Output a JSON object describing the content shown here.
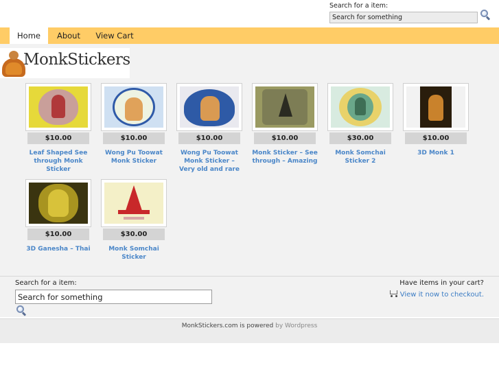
{
  "header": {
    "search_label": "Search for a item:",
    "search_value": "Search for something"
  },
  "nav": {
    "tabs": [
      {
        "label": "Home",
        "active": true
      },
      {
        "label": "About",
        "active": false
      },
      {
        "label": "View Cart",
        "active": false
      }
    ]
  },
  "logo": {
    "text": "MonkStickers",
    "icon": "monk-icon"
  },
  "products": [
    {
      "price": "$10.00",
      "name": "Leaf Shaped See through Monk Sticker"
    },
    {
      "price": "$10.00",
      "name": "Wong Pu Toowat Monk Sticker"
    },
    {
      "price": "$10.00",
      "name": "Wong Pu Toowat Monk Sticker – Very old and rare"
    },
    {
      "price": "$10.00",
      "name": "Monk Sticker – See through – Amazing"
    },
    {
      "price": "$30.00",
      "name": "Monk Somchai Sticker 2"
    },
    {
      "price": "$10.00",
      "name": "3D Monk 1"
    },
    {
      "price": "$10.00",
      "name": "3D Ganesha – Thai"
    },
    {
      "price": "$30.00",
      "name": "Monk Somchai Sticker"
    }
  ],
  "footer_search": {
    "label": "Search for a item:",
    "value": "Search for something"
  },
  "cart": {
    "question": "Have items in your cart?",
    "link": "View it now to checkout."
  },
  "powered": {
    "site": "MonkStickers.com is powered",
    "by": "by",
    "engine": "Wordpress"
  },
  "colors": {
    "nav_bg": "#ffcc66",
    "link": "#4a86c8",
    "price_bg": "#d4d4d4"
  }
}
